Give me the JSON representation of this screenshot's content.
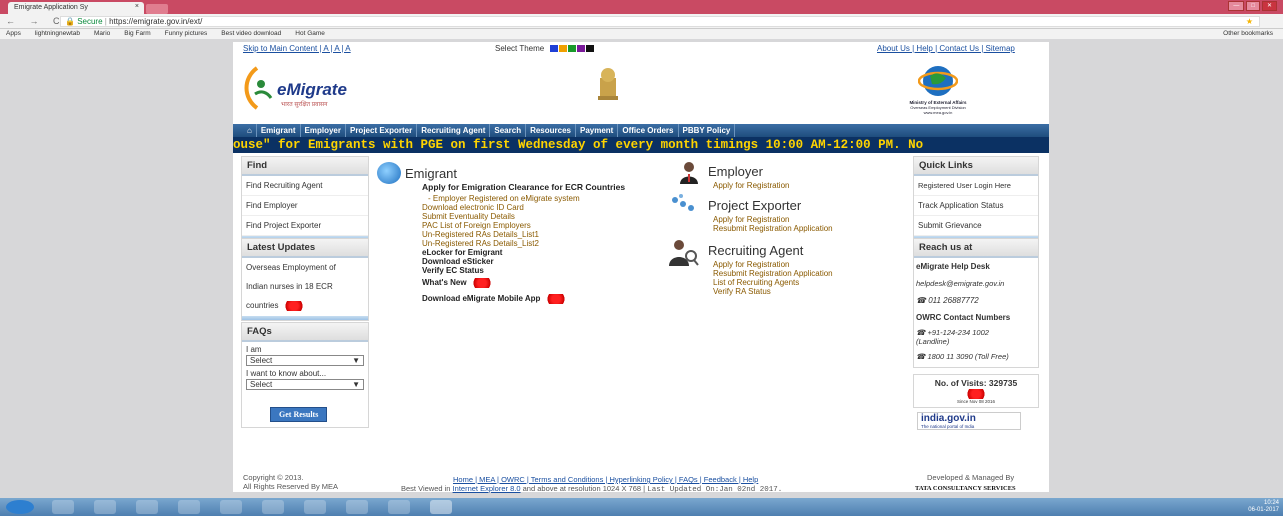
{
  "browser": {
    "tab_title": "Emigrate Application Sy",
    "tab_close": "×",
    "url_secure": "Secure",
    "url": "https://emigrate.gov.in/ext/",
    "nav": "← → C",
    "bookmarks": [
      "Apps",
      "lightningnewtab",
      "Mario",
      "Big Farm",
      "Funny pictures",
      "Best video download",
      "Hot Game"
    ],
    "other_bookmarks": "Other bookmarks"
  },
  "topbar": {
    "skip": "Skip to Main Content | A | A | A",
    "theme": "Select Theme",
    "links": "About Us | Help | Contact Us | Sitemap",
    "theme_colors": [
      "#1f3fd6",
      "#f0a000",
      "#1a9a2a",
      "#7a1a9a",
      "#111111"
    ]
  },
  "header": {
    "logo": "eMigrate",
    "logo_sub": "भारत सुरक्षित प्रवासन",
    "mea": "Ministry of External Affairs",
    "mea_sub": "Overseas Employment Division",
    "mea_url": "www.mea.gov.in"
  },
  "menu": [
    "⌂",
    "Emigrant",
    "Employer",
    "Project Exporter",
    "Recruiting Agent",
    "Search",
    "Resources",
    "Payment",
    "Office Orders",
    "PBBY Policy"
  ],
  "marquee": "ouse\" for Emigrants with PGE on first Wednesday of every month timings 10:00 AM-12:00 PM. No",
  "find": {
    "title": "Find",
    "items": [
      "Find Recruiting Agent",
      "Find Employer",
      "Find Project Exporter"
    ]
  },
  "updates": {
    "title": "Latest Updates",
    "lines": [
      "Overseas Employment of",
      "Indian nurses in 18 ECR",
      "countries"
    ]
  },
  "faqs": {
    "title": "FAQs",
    "iam": "I am",
    "select1": "Select",
    "know": "I want to know about...",
    "select2": "Select",
    "button": "Get Results"
  },
  "emigrant": {
    "title": "Emigrant",
    "lead": "Apply for Emigration Clearance for ECR Countries",
    "links": [
      "- Employer Registered on eMigrate system",
      "Download electronic ID Card",
      "Submit Eventuality Details",
      "PAC List of Foreign Employers",
      "Un-Registered RAs Details_List1",
      "Un-Registered RAs Details_List2"
    ],
    "bold": [
      "eLocker for Emigrant",
      "Download eSticker",
      "Verify EC Status",
      "What's New",
      "Download eMigrate Mobile App"
    ]
  },
  "employer": {
    "title": "Employer",
    "links": [
      "Apply for Registration"
    ]
  },
  "exporter": {
    "title": "Project Exporter",
    "links": [
      "Apply for Registration",
      "Resubmit Registration Application"
    ]
  },
  "agent": {
    "title": "Recruiting Agent",
    "links": [
      "Apply for Registration",
      "Resubmit Registration Application",
      "List of Recruiting Agents",
      "Verify RA Status"
    ]
  },
  "quick": {
    "title": "Quick Links",
    "items": [
      "Registered User Login Here",
      "Track Application Status",
      "Submit Grievance"
    ]
  },
  "reach": {
    "title": "Reach us at",
    "desk": "eMigrate Help Desk",
    "email": "helpdesk@emigrate.gov.in",
    "phone1": "011 26887772",
    "owrc": "OWRC Contact Numbers",
    "phone2": "+91-124-234 1002",
    "landline": "(Landline)",
    "phone3": "1800 11 3090 (Toll Free)"
  },
  "visits": {
    "label": "No. of Visits: 329735",
    "since": "Since Nov 08 2016"
  },
  "indiagov": {
    "name": "india.gov.in",
    "sub": "The national portal of India"
  },
  "footer": {
    "copyright": "Copyright © 2013.",
    "rights": "All Rights Reserved By MEA",
    "links": "Home | MEA | OWRC | Terms and Conditions | Hyperlinking Policy | FAQs | Feedback | Help",
    "best_prefix": "Best Viewed in",
    "best_link": "Internet Explorer 8.0",
    "best_suffix": "and above at resolution 1024 X 768 |",
    "updated": "Last Updated On:Jan 02nd 2017.",
    "developed": "Developed & Managed By",
    "tcs": "TATA CONSULTANCY SERVICES"
  },
  "tray": {
    "time": "10:24",
    "date": "06-01-2017"
  }
}
